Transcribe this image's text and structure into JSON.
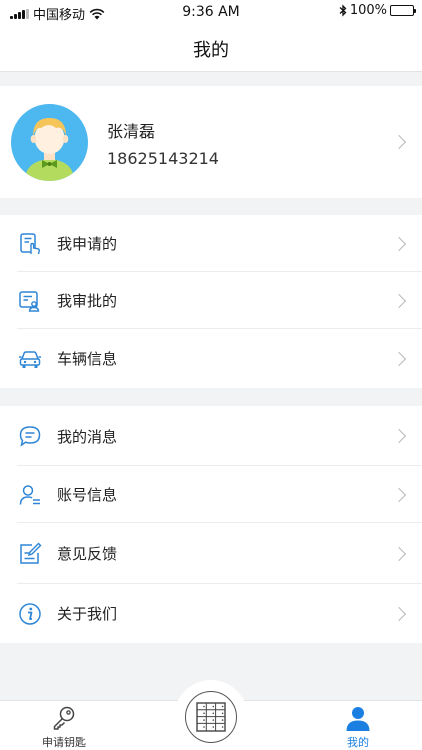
{
  "status_bar": {
    "carrier": "中国移动",
    "time": "9:36 AM",
    "battery": "100%"
  },
  "nav": {
    "title": "我的"
  },
  "profile": {
    "name": "张清磊",
    "phone": "18625143214"
  },
  "menu_group_1": [
    {
      "label": "我申请的",
      "icon": "apply-document-icon"
    },
    {
      "label": "我审批的",
      "icon": "approve-document-icon"
    },
    {
      "label": "车辆信息",
      "icon": "car-icon"
    }
  ],
  "menu_group_2": [
    {
      "label": "我的消息",
      "icon": "message-icon"
    },
    {
      "label": "账号信息",
      "icon": "account-icon"
    },
    {
      "label": "意见反馈",
      "icon": "feedback-icon"
    },
    {
      "label": "关于我们",
      "icon": "info-icon"
    }
  ],
  "tab_bar": {
    "left_label": "申请钥匙",
    "right_label": "我的",
    "active_color": "#1a7fe0"
  },
  "colors": {
    "accent": "#1a7fe0",
    "icon_blue": "#2f86d6",
    "avatar_bg": "#4db7ef"
  }
}
